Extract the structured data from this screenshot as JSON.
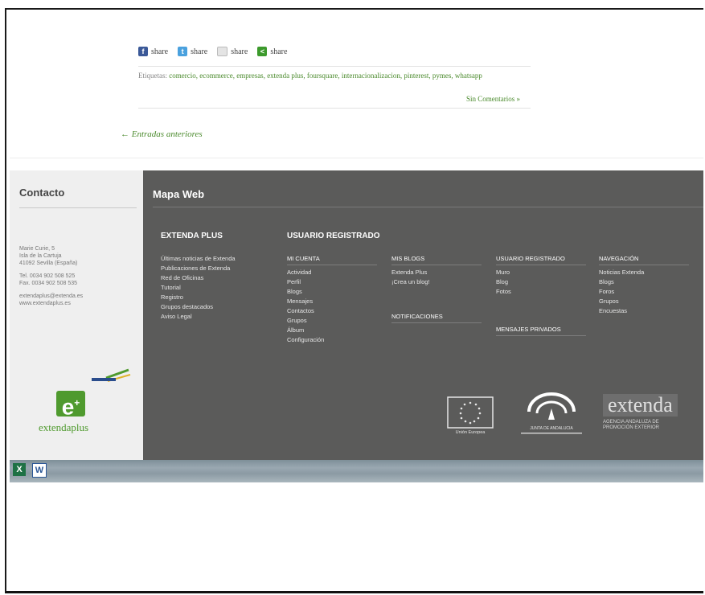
{
  "share": {
    "buttons": [
      {
        "label": "share",
        "color": "#3b5998",
        "glyph": "f"
      },
      {
        "label": "share",
        "color": "#4aa1de",
        "glyph": "t"
      },
      {
        "label": "share",
        "color": "#dddddd",
        "glyph": ""
      },
      {
        "label": "share",
        "color": "#3c9a2c",
        "glyph": "<"
      }
    ]
  },
  "post": {
    "tags_prefix": "Etiquetas:",
    "tags": "comercio, ecommerce, empresas, extenda plus, foursquare, internacionalizacion, pinterest, pymes, whatsapp",
    "comments": "Sin Comentarios »",
    "older_entries": "← Entradas anteriores"
  },
  "footer": {
    "contact": {
      "title": "Contacto",
      "address": [
        "Marie Curie, 5",
        "Isla de la Cartuja",
        "41092 Sevilla (España)"
      ],
      "phones": [
        "Tel. 0034 902 508 525",
        "Fax. 0034 902 508 535"
      ],
      "web": [
        "extendaplus@extenda.es",
        "www.extendaplus.es"
      ],
      "logo_text": "extendaplus"
    },
    "map": {
      "title": "Mapa Web",
      "section_extenda": "EXTENDA PLUS",
      "section_usuario": "USUARIO REGISTRADO",
      "extenda_items": [
        "Últimas noticias de Extenda",
        "Publicaciones de Extenda",
        "Red de Oficinas",
        "Tutorial",
        "Registro",
        "Grupos destacados",
        "Aviso Legal"
      ],
      "mi_cuenta": {
        "head": "MI CUENTA",
        "items": [
          "Actividad",
          "Perfil",
          "Blogs",
          "Mensajes",
          "Contactos",
          "Grupos",
          "Álbum",
          "Configuración"
        ]
      },
      "mis_blogs": {
        "head": "MIS BLOGS",
        "items": [
          "Extenda Plus",
          "¡Crea un blog!"
        ]
      },
      "notificaciones": {
        "head": "NOTIFICACIONES"
      },
      "usuario_registrado": {
        "head": "USUARIO REGISTRADO",
        "items": [
          "Muro",
          "Blog",
          "Fotos"
        ]
      },
      "mensajes_privados": {
        "head": "MENSAJES PRIVADOS"
      },
      "navegacion": {
        "head": "NAVEGACIÓN",
        "items": [
          "Noticias Extenda",
          "Blogs",
          "Foros",
          "Grupos",
          "Encuestas"
        ]
      }
    },
    "partners": {
      "ue": "Unión Europea",
      "junta": "JUNTA DE ANDALUCIA",
      "extenda": "extenda",
      "extenda_sub": [
        "AGENCIA ANDALUZA DE",
        "PROMOCIÓN EXTERIOR"
      ]
    }
  },
  "taskbar": {
    "icons": [
      {
        "name": "excel-icon",
        "glyph": "X",
        "color": "#1e7145"
      },
      {
        "name": "word-icon",
        "glyph": "W",
        "color": "#2b5797"
      }
    ]
  }
}
